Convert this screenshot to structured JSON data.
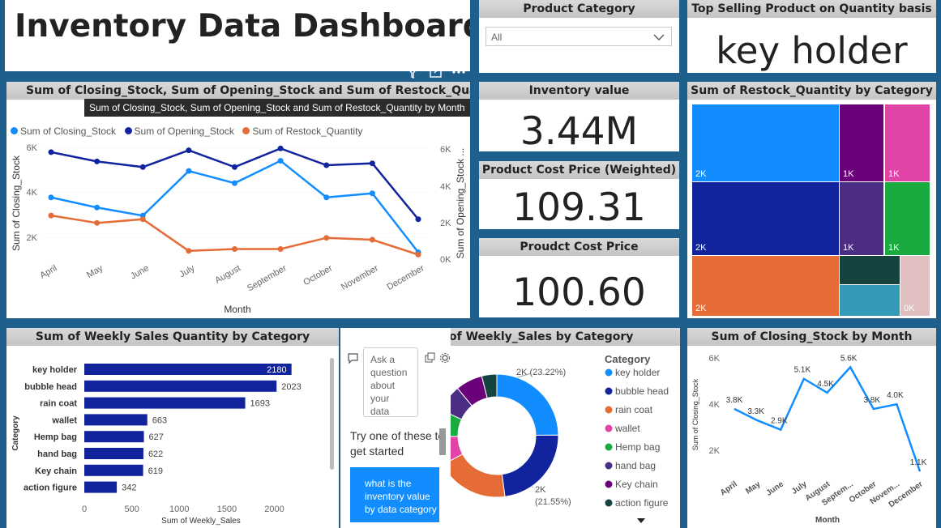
{
  "title": "Inventory Data Dashboard",
  "slicer": {
    "title": "Product Category",
    "value": "All"
  },
  "top_selling": {
    "title": "Top Selling Product on Quantity basis",
    "value": "key holder"
  },
  "kpis": [
    {
      "title": "Inventory value",
      "value": "3.44M"
    },
    {
      "title": "Product Cost Price (Weighted)",
      "value": "109.31"
    },
    {
      "title": "Proudct Cost Price",
      "value": "100.60"
    }
  ],
  "combo_chart": {
    "title": "Sum of Closing_Stock, Sum of Opening_Stock and Sum of Restock_Quantity by",
    "tooltip": "Sum of Closing_Stock, Sum of Opening_Stock and Sum of Restock_Quantity by Month",
    "xlabel": "Month",
    "ylabel_left": "Sum of Closing_Stock",
    "ylabel_right": "Sum of Opening_Stock ...",
    "left_ticks": [
      "6K",
      "4K",
      "2K"
    ],
    "right_ticks": [
      "6K",
      "4K",
      "2K",
      "0K"
    ],
    "legend": [
      "Sum of Closing_Stock",
      "Sum of Opening_Stock",
      "Sum of Restock_Quantity"
    ]
  },
  "treemap": {
    "title": "Sum of Restock_Quantity by Category",
    "tiles": [
      {
        "label": "2K",
        "color": "#118dff"
      },
      {
        "label": "1K",
        "color": "#6b007b"
      },
      {
        "label": "1K",
        "color": "#e044a7"
      },
      {
        "label": "2K",
        "color": "#12239e"
      },
      {
        "label": "1K",
        "color": "#4b2e83"
      },
      {
        "label": "1K",
        "color": "#1aab40"
      },
      {
        "label": "2K",
        "color": "#e66c37"
      },
      {
        "label": "",
        "color": "#15433f"
      },
      {
        "label": "",
        "color": "#3599b8"
      },
      {
        "label": "0K",
        "color": "#dfbfbf"
      }
    ]
  },
  "bar_chart_panel": {
    "title": "Sum of Weekly Sales Quantity by Category",
    "xlabel": "Sum of Weekly_Sales",
    "ylabel": "Category"
  },
  "qa": {
    "placeholder": "Ask a question about your data",
    "prompt": "Try one of these to get started",
    "suggestion": "what is the inventory value by data category"
  },
  "donut_panel": {
    "title": "of Weekly_Sales by Category",
    "legend_title": "Category",
    "label_a": "2K (23.22%)",
    "label_b": "2K",
    "label_b2": "(21.55%)"
  },
  "closing_panel": {
    "title": "Sum of Closing_Stock by Month",
    "xlabel": "Month",
    "ylabel": "Sum of Closing_Stock",
    "ticks": [
      "6K",
      "4K",
      "2K"
    ]
  },
  "chart_data": [
    {
      "type": "line",
      "title": "Sum of Closing_Stock, Sum of Opening_Stock and Sum of Restock_Quantity by",
      "x": [
        "April",
        "May",
        "June",
        "July",
        "August",
        "September",
        "October",
        "November",
        "December"
      ],
      "xlabel": "Month",
      "series": [
        {
          "name": "Sum of Closing_Stock",
          "axis": "left",
          "color": "#118dff",
          "values": [
            3800,
            3300,
            2900,
            5100,
            4500,
            5600,
            3800,
            4000,
            1100
          ]
        },
        {
          "name": "Sum of Opening_Stock",
          "axis": "right",
          "color": "#12239e",
          "values": [
            5700,
            5200,
            4900,
            5800,
            4900,
            5900,
            5000,
            5100,
            2100
          ]
        },
        {
          "name": "Sum of Restock_Quantity",
          "axis": "right",
          "color": "#e66c37",
          "values": [
            2300,
            1900,
            2100,
            400,
            500,
            500,
            1100,
            1000,
            200
          ]
        }
      ],
      "ylim_left": [
        800,
        6300
      ],
      "ylim_right": [
        0,
        6000
      ],
      "grid": true,
      "legend": "top-left"
    },
    {
      "type": "bar",
      "orientation": "horizontal",
      "title": "Sum of Weekly Sales Quantity by Category",
      "categories": [
        "key holder",
        "bubble head",
        "rain coat",
        "wallet",
        "Hemp bag",
        "hand bag",
        "Key chain",
        "action figure"
      ],
      "values": [
        2180,
        2023,
        1693,
        663,
        627,
        622,
        619,
        342
      ],
      "xlabel": "Sum of Weekly_Sales",
      "ylabel": "Category",
      "xlim": [
        0,
        2200
      ],
      "xticks": [
        0,
        500,
        1000,
        1500,
        2000
      ],
      "color": "#12239e"
    },
    {
      "type": "pie",
      "title": "of Weekly_Sales by Category",
      "donut": true,
      "legend_title": "Category",
      "categories": [
        "key holder",
        "bubble head",
        "rain coat",
        "wallet",
        "Hemp bag",
        "hand bag",
        "Key chain",
        "action figure"
      ],
      "values": [
        23.22,
        21.55,
        18.0,
        7.1,
        6.7,
        6.6,
        6.6,
        3.7
      ],
      "colors": [
        "#118dff",
        "#12239e",
        "#e66c37",
        "#e044a7",
        "#1aab40",
        "#4b2e83",
        "#6b007b",
        "#15433f"
      ]
    },
    {
      "type": "line",
      "title": "Sum of Closing_Stock by Month",
      "x": [
        "April",
        "May",
        "June",
        "July",
        "August",
        "Septem...",
        "October",
        "Novem...",
        "December"
      ],
      "values": [
        3800,
        3300,
        2900,
        5100,
        4500,
        5600,
        3800,
        4000,
        1100
      ],
      "labels": [
        "3.8K",
        "3.3K",
        "2.9K",
        "5.1K",
        "4.5K",
        "5.6K",
        "3.8K",
        "4.0K",
        "1.1K"
      ],
      "xlabel": "Month",
      "ylabel": "Sum of Closing_Stock",
      "ylim": [
        1000,
        6000
      ],
      "color": "#118dff"
    }
  ]
}
